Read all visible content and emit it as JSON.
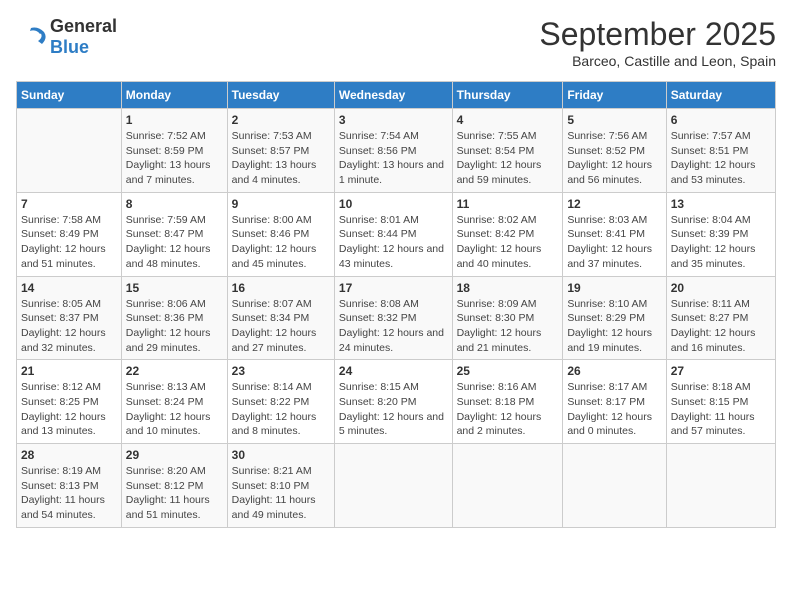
{
  "logo": {
    "text_general": "General",
    "text_blue": "Blue"
  },
  "title": "September 2025",
  "subtitle": "Barceo, Castille and Leon, Spain",
  "days_of_week": [
    "Sunday",
    "Monday",
    "Tuesday",
    "Wednesday",
    "Thursday",
    "Friday",
    "Saturday"
  ],
  "weeks": [
    [
      {
        "day": "",
        "sunrise": "",
        "sunset": "",
        "daylight": ""
      },
      {
        "day": "1",
        "sunrise": "Sunrise: 7:52 AM",
        "sunset": "Sunset: 8:59 PM",
        "daylight": "Daylight: 13 hours and 7 minutes."
      },
      {
        "day": "2",
        "sunrise": "Sunrise: 7:53 AM",
        "sunset": "Sunset: 8:57 PM",
        "daylight": "Daylight: 13 hours and 4 minutes."
      },
      {
        "day": "3",
        "sunrise": "Sunrise: 7:54 AM",
        "sunset": "Sunset: 8:56 PM",
        "daylight": "Daylight: 13 hours and 1 minute."
      },
      {
        "day": "4",
        "sunrise": "Sunrise: 7:55 AM",
        "sunset": "Sunset: 8:54 PM",
        "daylight": "Daylight: 12 hours and 59 minutes."
      },
      {
        "day": "5",
        "sunrise": "Sunrise: 7:56 AM",
        "sunset": "Sunset: 8:52 PM",
        "daylight": "Daylight: 12 hours and 56 minutes."
      },
      {
        "day": "6",
        "sunrise": "Sunrise: 7:57 AM",
        "sunset": "Sunset: 8:51 PM",
        "daylight": "Daylight: 12 hours and 53 minutes."
      }
    ],
    [
      {
        "day": "7",
        "sunrise": "Sunrise: 7:58 AM",
        "sunset": "Sunset: 8:49 PM",
        "daylight": "Daylight: 12 hours and 51 minutes."
      },
      {
        "day": "8",
        "sunrise": "Sunrise: 7:59 AM",
        "sunset": "Sunset: 8:47 PM",
        "daylight": "Daylight: 12 hours and 48 minutes."
      },
      {
        "day": "9",
        "sunrise": "Sunrise: 8:00 AM",
        "sunset": "Sunset: 8:46 PM",
        "daylight": "Daylight: 12 hours and 45 minutes."
      },
      {
        "day": "10",
        "sunrise": "Sunrise: 8:01 AM",
        "sunset": "Sunset: 8:44 PM",
        "daylight": "Daylight: 12 hours and 43 minutes."
      },
      {
        "day": "11",
        "sunrise": "Sunrise: 8:02 AM",
        "sunset": "Sunset: 8:42 PM",
        "daylight": "Daylight: 12 hours and 40 minutes."
      },
      {
        "day": "12",
        "sunrise": "Sunrise: 8:03 AM",
        "sunset": "Sunset: 8:41 PM",
        "daylight": "Daylight: 12 hours and 37 minutes."
      },
      {
        "day": "13",
        "sunrise": "Sunrise: 8:04 AM",
        "sunset": "Sunset: 8:39 PM",
        "daylight": "Daylight: 12 hours and 35 minutes."
      }
    ],
    [
      {
        "day": "14",
        "sunrise": "Sunrise: 8:05 AM",
        "sunset": "Sunset: 8:37 PM",
        "daylight": "Daylight: 12 hours and 32 minutes."
      },
      {
        "day": "15",
        "sunrise": "Sunrise: 8:06 AM",
        "sunset": "Sunset: 8:36 PM",
        "daylight": "Daylight: 12 hours and 29 minutes."
      },
      {
        "day": "16",
        "sunrise": "Sunrise: 8:07 AM",
        "sunset": "Sunset: 8:34 PM",
        "daylight": "Daylight: 12 hours and 27 minutes."
      },
      {
        "day": "17",
        "sunrise": "Sunrise: 8:08 AM",
        "sunset": "Sunset: 8:32 PM",
        "daylight": "Daylight: 12 hours and 24 minutes."
      },
      {
        "day": "18",
        "sunrise": "Sunrise: 8:09 AM",
        "sunset": "Sunset: 8:30 PM",
        "daylight": "Daylight: 12 hours and 21 minutes."
      },
      {
        "day": "19",
        "sunrise": "Sunrise: 8:10 AM",
        "sunset": "Sunset: 8:29 PM",
        "daylight": "Daylight: 12 hours and 19 minutes."
      },
      {
        "day": "20",
        "sunrise": "Sunrise: 8:11 AM",
        "sunset": "Sunset: 8:27 PM",
        "daylight": "Daylight: 12 hours and 16 minutes."
      }
    ],
    [
      {
        "day": "21",
        "sunrise": "Sunrise: 8:12 AM",
        "sunset": "Sunset: 8:25 PM",
        "daylight": "Daylight: 12 hours and 13 minutes."
      },
      {
        "day": "22",
        "sunrise": "Sunrise: 8:13 AM",
        "sunset": "Sunset: 8:24 PM",
        "daylight": "Daylight: 12 hours and 10 minutes."
      },
      {
        "day": "23",
        "sunrise": "Sunrise: 8:14 AM",
        "sunset": "Sunset: 8:22 PM",
        "daylight": "Daylight: 12 hours and 8 minutes."
      },
      {
        "day": "24",
        "sunrise": "Sunrise: 8:15 AM",
        "sunset": "Sunset: 8:20 PM",
        "daylight": "Daylight: 12 hours and 5 minutes."
      },
      {
        "day": "25",
        "sunrise": "Sunrise: 8:16 AM",
        "sunset": "Sunset: 8:18 PM",
        "daylight": "Daylight: 12 hours and 2 minutes."
      },
      {
        "day": "26",
        "sunrise": "Sunrise: 8:17 AM",
        "sunset": "Sunset: 8:17 PM",
        "daylight": "Daylight: 12 hours and 0 minutes."
      },
      {
        "day": "27",
        "sunrise": "Sunrise: 8:18 AM",
        "sunset": "Sunset: 8:15 PM",
        "daylight": "Daylight: 11 hours and 57 minutes."
      }
    ],
    [
      {
        "day": "28",
        "sunrise": "Sunrise: 8:19 AM",
        "sunset": "Sunset: 8:13 PM",
        "daylight": "Daylight: 11 hours and 54 minutes."
      },
      {
        "day": "29",
        "sunrise": "Sunrise: 8:20 AM",
        "sunset": "Sunset: 8:12 PM",
        "daylight": "Daylight: 11 hours and 51 minutes."
      },
      {
        "day": "30",
        "sunrise": "Sunrise: 8:21 AM",
        "sunset": "Sunset: 8:10 PM",
        "daylight": "Daylight: 11 hours and 49 minutes."
      },
      {
        "day": "",
        "sunrise": "",
        "sunset": "",
        "daylight": ""
      },
      {
        "day": "",
        "sunrise": "",
        "sunset": "",
        "daylight": ""
      },
      {
        "day": "",
        "sunrise": "",
        "sunset": "",
        "daylight": ""
      },
      {
        "day": "",
        "sunrise": "",
        "sunset": "",
        "daylight": ""
      }
    ]
  ]
}
